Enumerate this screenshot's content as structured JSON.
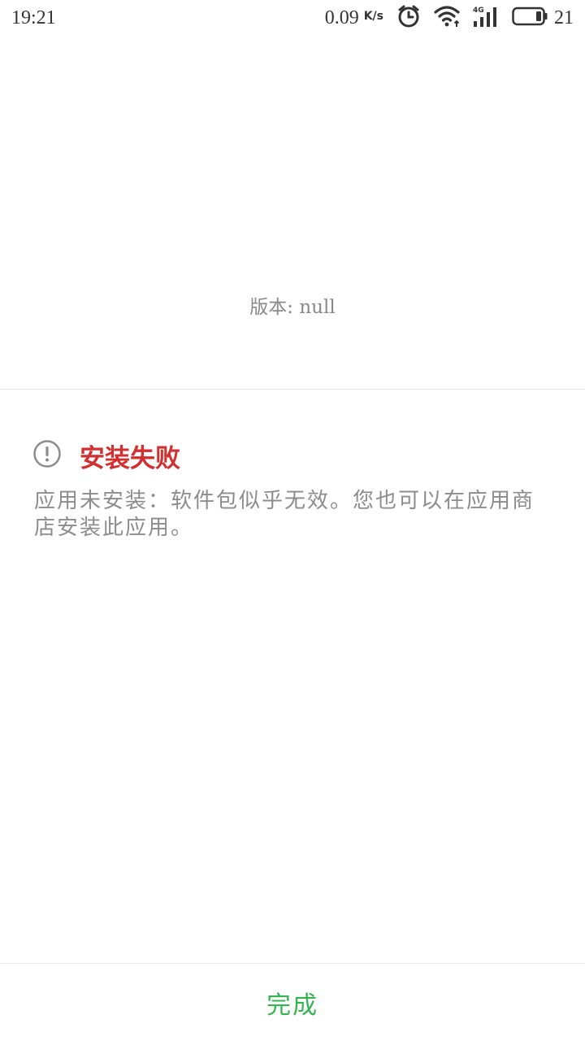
{
  "status_bar": {
    "time": "19:21",
    "net_speed": "0.09",
    "net_speed_unit": "K/s",
    "battery_level": "21",
    "icons": [
      "alarm-icon",
      "wifi-icon",
      "4g-signal-icon",
      "battery-icon"
    ]
  },
  "app_info": {
    "version_text": "版本: null"
  },
  "error": {
    "icon": "exclamation-circle-icon",
    "title": "安装失败",
    "message": "应用未安装：软件包似乎无效。您也可以在应用商店安装此应用。"
  },
  "footer": {
    "done_label": "完成"
  },
  "colors": {
    "error_title": "#d0302f",
    "done_button": "#35b550",
    "muted_text": "#8c8c8c",
    "divider": "#e8e8e8"
  }
}
